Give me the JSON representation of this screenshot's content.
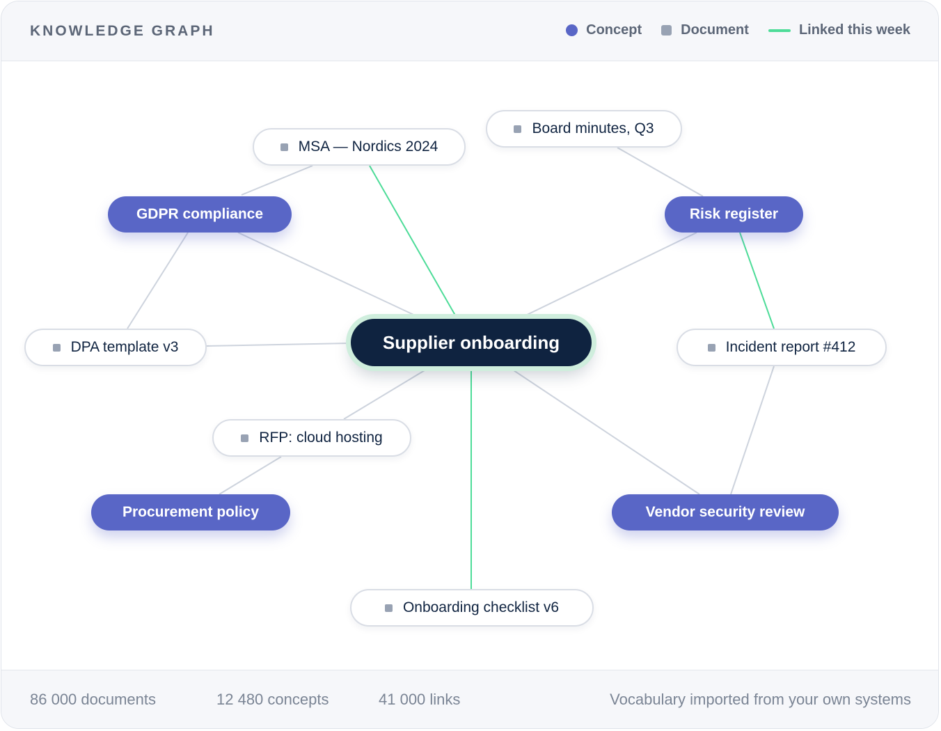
{
  "header": {
    "title": "KNOWLEDGE GRAPH",
    "legend": {
      "concept": "Concept",
      "document": "Document",
      "linked": "Linked this week"
    }
  },
  "colors": {
    "concept": "#5966c6",
    "document": "#98a2b3",
    "linked_edge": "#4ddc98",
    "edge": "#cdd3dd",
    "center": "#0f2340"
  },
  "graph": {
    "center": "Supplier onboarding",
    "concepts": [
      {
        "id": "gdpr",
        "label": "GDPR compliance"
      },
      {
        "id": "risk",
        "label": "Risk register"
      },
      {
        "id": "procurement",
        "label": "Procurement policy"
      },
      {
        "id": "vendor",
        "label": "Vendor security review"
      }
    ],
    "documents": [
      {
        "id": "msa",
        "label": "MSA — Nordics 2024"
      },
      {
        "id": "board",
        "label": "Board minutes, Q3"
      },
      {
        "id": "dpa",
        "label": "DPA template v3"
      },
      {
        "id": "incident",
        "label": "Incident report #412"
      },
      {
        "id": "rfp",
        "label": "RFP: cloud hosting"
      },
      {
        "id": "checklist",
        "label": "Onboarding checklist v6"
      }
    ],
    "edges": [
      {
        "from": "gdpr",
        "to": "msa",
        "linked_this_week": false
      },
      {
        "from": "gdpr",
        "to": "center",
        "linked_this_week": false
      },
      {
        "from": "gdpr",
        "to": "dpa",
        "linked_this_week": false
      },
      {
        "from": "msa",
        "to": "center",
        "linked_this_week": true
      },
      {
        "from": "board",
        "to": "risk",
        "linked_this_week": false
      },
      {
        "from": "risk",
        "to": "center",
        "linked_this_week": false
      },
      {
        "from": "risk",
        "to": "incident",
        "linked_this_week": true
      },
      {
        "from": "dpa",
        "to": "center",
        "linked_this_week": false
      },
      {
        "from": "incident",
        "to": "vendor",
        "linked_this_week": false
      },
      {
        "from": "center",
        "to": "rfp",
        "linked_this_week": false
      },
      {
        "from": "rfp",
        "to": "procurement",
        "linked_this_week": false
      },
      {
        "from": "center",
        "to": "vendor",
        "linked_this_week": false
      },
      {
        "from": "center",
        "to": "checklist",
        "linked_this_week": true
      }
    ]
  },
  "footer": {
    "documents": "86 000 documents",
    "concepts": "12 480 concepts",
    "links": "41 000 links",
    "note": "Vocabulary imported from your own systems"
  }
}
